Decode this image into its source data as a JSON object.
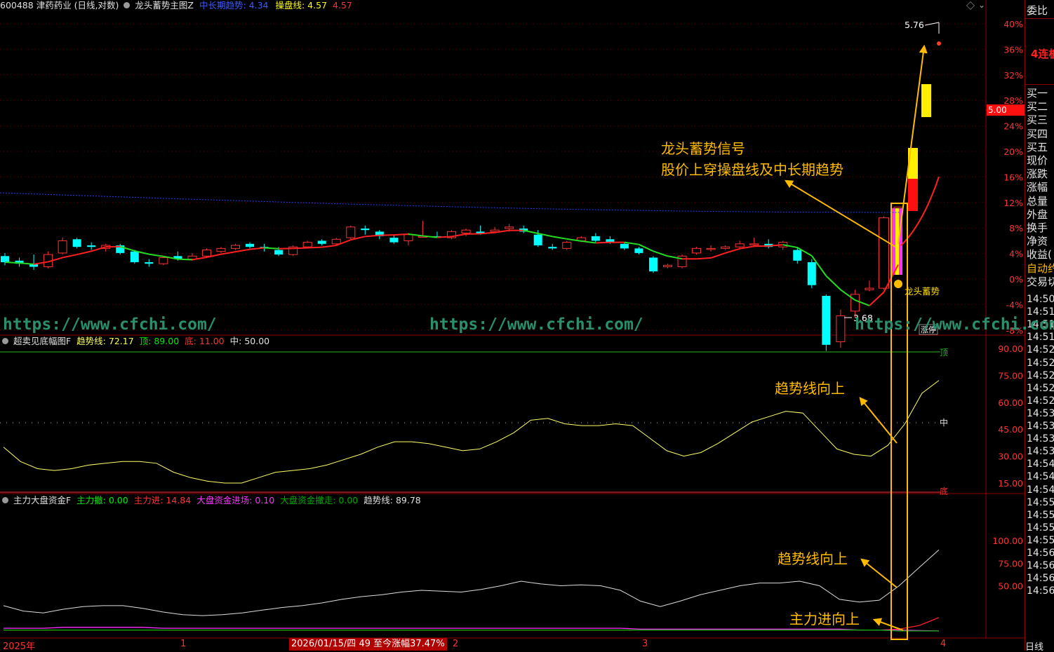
{
  "header": {
    "code_name": "600488 津药药业 (日线,对数)",
    "indicator": "龙头蓄势主图Z",
    "mid_long_label": "中长期趋势:",
    "mid_long_value": "4.34",
    "op_label": "操盘线:",
    "op_value": "4.57",
    "op_value2": "4.57"
  },
  "sub1": {
    "title": "超卖见底幅图F",
    "trend_label": "趋势线:",
    "trend_value": "72.17",
    "top_label": "顶:",
    "top_value": "89.00",
    "bottom_label": "底:",
    "bottom_value": "11.00",
    "mid_label": "中:",
    "mid_value": "50.00"
  },
  "sub2": {
    "title": "主力大盘资金F",
    "withdraw_label": "主力撤:",
    "withdraw_value": "0.00",
    "enter_label": "主力进:",
    "enter_value": "14.84",
    "big_in_label": "大盘资金进场:",
    "big_in_value": "0.10",
    "big_out_label": "大盘资金撤走:",
    "big_out_value": "0.00",
    "trend_label": "趋势线:",
    "trend_value": "89.78"
  },
  "annotations": {
    "signal_line1": "龙头蓄势信号",
    "signal_line2": "股价上穿操盘线及中长期趋势",
    "trend_up_1": "趋势线向上",
    "trend_up_2": "趋势线向上",
    "main_up": "主力进向上",
    "longtou_tag": "龙头蓄势",
    "zhangting_tag": "涨停",
    "high_price": "5.76",
    "low_price": "3.68",
    "current_price_tag": "5.00"
  },
  "watermarks": [
    "https://www.cfchi.com/",
    "https://www.cfchi.com/",
    "https://www.cfchi.com/"
  ],
  "bottom_axis": {
    "year_label": "2025年",
    "month1": "1",
    "date_info": "2026/01/15/四 49 至今涨幅37.47%",
    "month2": "2",
    "month3": "3",
    "month4": "4",
    "period_label": "日线"
  },
  "sub1_side_labels": {
    "top": "顶",
    "mid": "中",
    "bottom": "底"
  },
  "right_panel": {
    "header": "委比",
    "board": "4连板",
    "items": [
      "买一",
      "买二",
      "买三",
      "买四",
      "买五",
      "现价",
      "涨跌",
      "涨幅",
      "总量",
      "外盘",
      "换手",
      "净资",
      "收益(",
      "自动约",
      "交易切"
    ],
    "times": [
      "14:50",
      "14:51",
      "14:51",
      "14:51",
      "14:52",
      "14:52",
      "14:52",
      "14:52",
      "14:52",
      "14:53",
      "14:53",
      "14:53",
      "14:53",
      "14:54",
      "14:54",
      "14:54",
      "14:55",
      "14:55",
      "14:55",
      "14:55",
      "14:56",
      "14:56",
      "14:56",
      "14:56"
    ]
  },
  "chart_data": [
    {
      "type": "candlestick",
      "title": "600488 津药药业 (日线,对数)",
      "y_axis_pct_ticks": [
        "40%",
        "36%",
        "32%",
        "28%",
        "24%",
        "20%",
        "16%",
        "12%",
        "8%",
        "4%",
        "0%",
        "-4%",
        "-8%"
      ],
      "annotated_high": 5.76,
      "annotated_low": 3.68,
      "series": [
        {
          "name": "中长期趋势",
          "last_value": 4.34,
          "color": "#0000ff"
        },
        {
          "name": "操盘线",
          "last_value": 4.57,
          "color": "#00ff00/#ff0000"
        }
      ],
      "ohlc": [
        [
          4.32,
          4.34,
          4.26,
          4.28
        ],
        [
          4.29,
          4.31,
          4.25,
          4.27
        ],
        [
          4.27,
          4.33,
          4.23,
          4.25
        ],
        [
          4.25,
          4.35,
          4.24,
          4.33
        ],
        [
          4.34,
          4.44,
          4.33,
          4.42
        ],
        [
          4.43,
          4.44,
          4.37,
          4.38
        ],
        [
          4.39,
          4.41,
          4.36,
          4.38
        ],
        [
          4.37,
          4.4,
          4.35,
          4.39
        ],
        [
          4.39,
          4.4,
          4.33,
          4.34
        ],
        [
          4.35,
          4.36,
          4.27,
          4.28
        ],
        [
          4.28,
          4.3,
          4.25,
          4.27
        ],
        [
          4.27,
          4.32,
          4.26,
          4.31
        ],
        [
          4.32,
          4.35,
          4.29,
          4.3
        ],
        [
          4.3,
          4.34,
          4.29,
          4.32
        ],
        [
          4.32,
          4.37,
          4.31,
          4.36
        ],
        [
          4.35,
          4.38,
          4.34,
          4.37
        ],
        [
          4.37,
          4.4,
          4.36,
          4.39
        ],
        [
          4.4,
          4.41,
          4.37,
          4.38
        ],
        [
          4.38,
          4.4,
          4.35,
          4.37
        ],
        [
          4.36,
          4.38,
          4.32,
          4.33
        ],
        [
          4.33,
          4.39,
          4.32,
          4.38
        ],
        [
          4.38,
          4.42,
          4.37,
          4.41
        ],
        [
          4.42,
          4.43,
          4.39,
          4.4
        ],
        [
          4.4,
          4.44,
          4.39,
          4.43
        ],
        [
          4.44,
          4.52,
          4.43,
          4.51
        ],
        [
          4.5,
          4.52,
          4.46,
          4.49
        ],
        [
          4.48,
          4.49,
          4.43,
          4.45
        ],
        [
          4.44,
          4.46,
          4.4,
          4.41
        ],
        [
          4.42,
          4.47,
          4.39,
          4.46
        ],
        [
          4.45,
          4.55,
          4.44,
          4.45
        ],
        [
          4.45,
          4.48,
          4.44,
          4.44
        ],
        [
          4.44,
          4.49,
          4.43,
          4.48
        ],
        [
          4.47,
          4.5,
          4.45,
          4.49
        ],
        [
          4.48,
          4.52,
          4.46,
          4.47
        ],
        [
          4.48,
          4.51,
          4.47,
          4.49
        ],
        [
          4.5,
          4.53,
          4.48,
          4.51
        ],
        [
          4.5,
          4.52,
          4.47,
          4.48
        ],
        [
          4.46,
          4.49,
          4.38,
          4.39
        ],
        [
          4.38,
          4.4,
          4.36,
          4.37
        ],
        [
          4.37,
          4.42,
          4.36,
          4.41
        ],
        [
          4.42,
          4.45,
          4.41,
          4.44
        ],
        [
          4.45,
          4.47,
          4.41,
          4.42
        ],
        [
          4.43,
          4.45,
          4.4,
          4.41
        ],
        [
          4.4,
          4.41,
          4.36,
          4.37
        ],
        [
          4.37,
          4.38,
          4.33,
          4.34
        ],
        [
          4.31,
          4.32,
          4.21,
          4.22
        ],
        [
          4.25,
          4.27,
          4.24,
          4.26
        ],
        [
          4.25,
          4.33,
          4.24,
          4.32
        ],
        [
          4.34,
          4.38,
          4.33,
          4.37
        ],
        [
          4.37,
          4.39,
          4.35,
          4.37
        ],
        [
          4.37,
          4.39,
          4.36,
          4.38
        ],
        [
          4.38,
          4.42,
          4.37,
          4.4
        ],
        [
          4.4,
          4.44,
          4.38,
          4.4
        ],
        [
          4.4,
          4.43,
          4.37,
          4.38
        ],
        [
          4.38,
          4.42,
          4.36,
          4.41
        ],
        [
          4.36,
          4.38,
          4.27,
          4.29
        ],
        [
          4.28,
          4.3,
          4.11,
          4.13
        ],
        [
          4.06,
          4.07,
          3.7,
          3.74
        ],
        [
          3.76,
          3.97,
          3.72,
          3.93
        ],
        [
          3.96,
          4.1,
          3.92,
          4.07
        ],
        [
          4.1,
          4.16,
          4.09,
          4.11
        ],
        [
          4.11,
          4.58,
          4.1,
          4.57
        ],
        [
          4.59,
          4.64,
          4.58,
          4.64
        ]
      ]
    },
    {
      "type": "line",
      "title": "超卖见底幅图F",
      "y_ticks": [
        90,
        75,
        60,
        45,
        30,
        15
      ],
      "reference_lines": {
        "顶": 89,
        "中": 50,
        "底": 11
      },
      "series": [
        {
          "name": "趋势线",
          "color": "#ffff66",
          "values": [
            35,
            27,
            23,
            22,
            23,
            25,
            26,
            27,
            27,
            26,
            21,
            18,
            16,
            15,
            15,
            18,
            21,
            22,
            23,
            25,
            28,
            31,
            35,
            38,
            38,
            37,
            35,
            33,
            34,
            38,
            43,
            50,
            51,
            48,
            47,
            47,
            48,
            47,
            40,
            33,
            30,
            32,
            37,
            43,
            49,
            52,
            55,
            54,
            44,
            34,
            31,
            30,
            36,
            48,
            65,
            72.17
          ]
        }
      ]
    },
    {
      "type": "line",
      "title": "主力大盘资金F",
      "y_ticks": [
        100,
        75,
        50
      ],
      "series": [
        {
          "name": "趋势线",
          "color": "#dddddd",
          "values": [
            28,
            22,
            20,
            24,
            27,
            28,
            28,
            25,
            21,
            18,
            17,
            18,
            20,
            23,
            26,
            28,
            31,
            35,
            38,
            40,
            43,
            45,
            44,
            43,
            46,
            50,
            55,
            52,
            50,
            51,
            50,
            45,
            33,
            27,
            33,
            40,
            45,
            50,
            53,
            53,
            55,
            50,
            35,
            32,
            34,
            50,
            70,
            89.78
          ]
        },
        {
          "name": "主力进",
          "color": "#ff2020",
          "values": [
            1,
            1,
            1,
            1,
            1,
            1,
            1,
            1,
            1,
            1,
            1,
            1,
            1,
            1,
            1,
            1,
            1,
            1,
            1,
            1,
            1,
            1,
            1,
            1,
            1,
            1,
            1,
            1,
            1,
            1,
            1,
            1,
            1,
            1,
            1,
            1,
            1,
            1,
            1,
            1,
            1,
            1,
            1,
            1,
            1,
            2,
            6,
            14.84
          ]
        },
        {
          "name": "大盘资金进场",
          "color": "#ff30ff",
          "values": [
            3,
            3,
            3,
            4,
            4,
            4,
            4,
            4,
            3,
            3,
            3,
            3,
            3,
            3,
            3,
            3,
            3,
            3,
            3,
            3,
            3,
            3,
            3,
            3,
            3,
            3,
            3,
            3,
            3,
            3,
            3,
            3,
            2,
            2,
            2,
            2,
            2,
            2,
            2,
            2,
            2,
            2,
            2,
            1,
            1,
            1,
            0.5,
            0.1
          ]
        },
        {
          "name": "大盘资金撤走",
          "color": "#00aa00",
          "values": [
            1,
            1,
            1,
            1,
            1,
            1,
            1,
            1,
            1,
            1,
            1,
            1,
            1,
            1,
            1,
            1,
            1,
            1,
            1,
            1,
            1,
            1,
            1,
            1,
            1,
            1,
            1,
            1,
            1,
            1,
            1,
            1,
            1,
            1,
            1,
            1,
            1,
            1,
            1,
            1,
            1,
            1,
            1,
            1,
            1,
            0,
            0,
            0
          ]
        }
      ]
    }
  ],
  "colors": {
    "up": "#ff3232",
    "down": "#00ffff",
    "accent": "#ffbb00",
    "grid": "#8b0000"
  }
}
